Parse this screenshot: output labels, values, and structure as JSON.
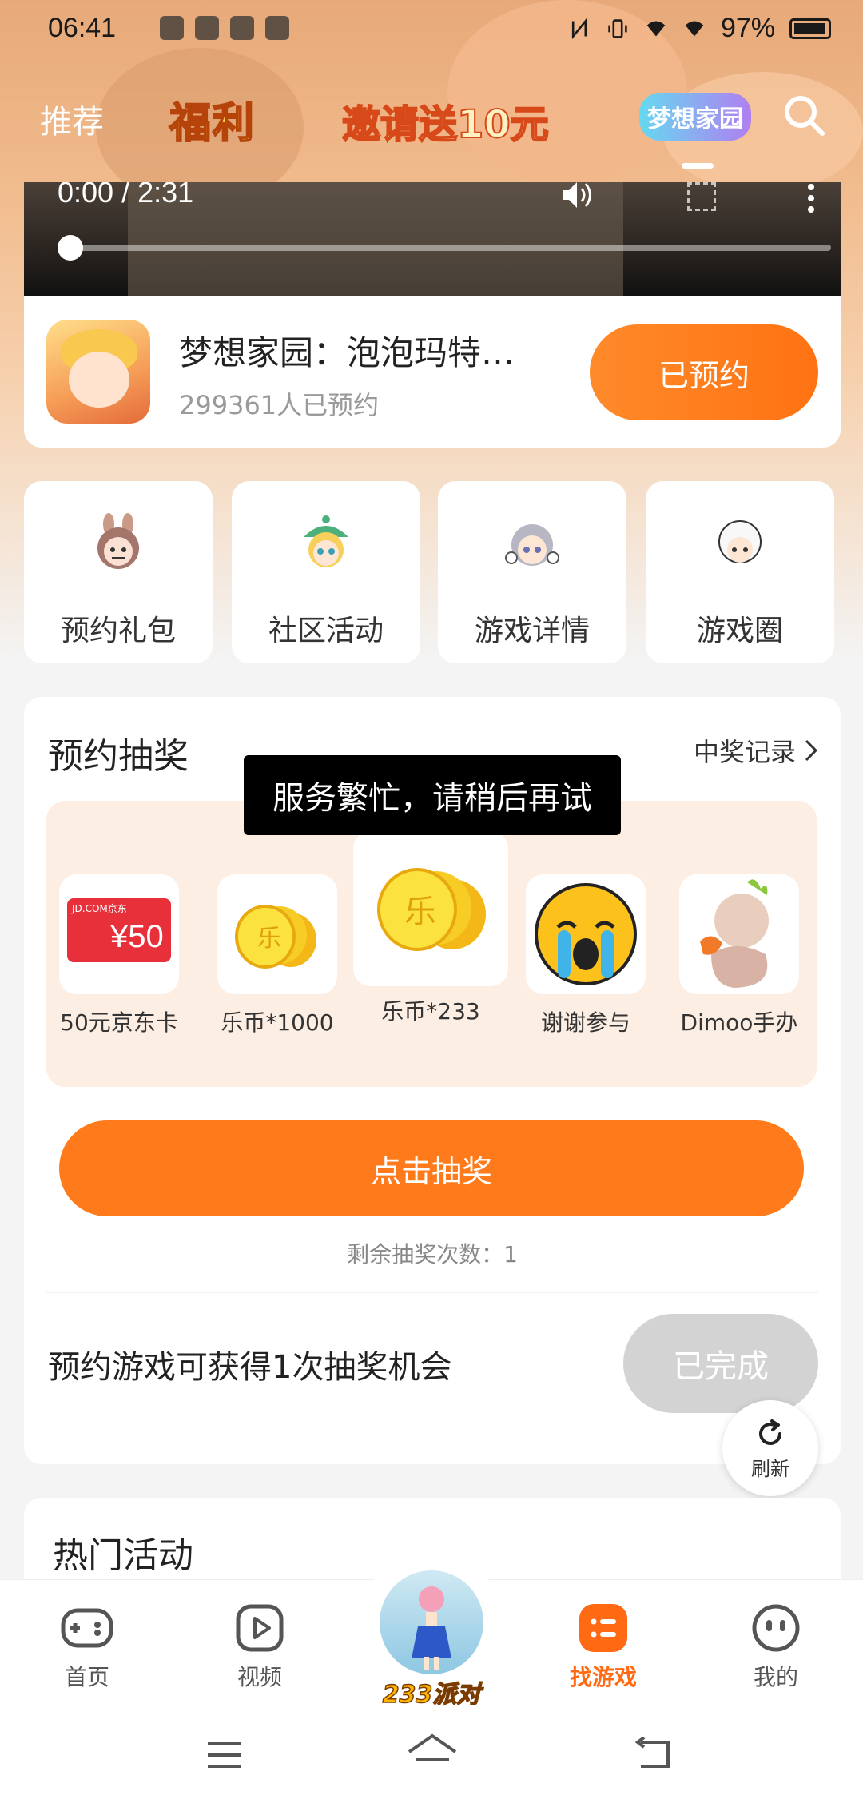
{
  "status_bar": {
    "time": "06:41",
    "battery": "97%"
  },
  "top_nav": {
    "recommend": "推荐",
    "fuli": "福利",
    "invite": "邀请送10元",
    "logo": "梦想家园"
  },
  "video": {
    "time": "0:00 / 2:31",
    "progress": 0.0
  },
  "game": {
    "title": "梦想家园：泡泡玛特…",
    "reservations": "299361人已预约",
    "reserve_button": "已预约"
  },
  "quick_entries": [
    {
      "label": "预约礼包",
      "icon": "labubu-icon"
    },
    {
      "label": "社区活动",
      "icon": "green-hat-girl-icon"
    },
    {
      "label": "游戏详情",
      "icon": "gray-hair-girl-icon"
    },
    {
      "label": "游戏圈",
      "icon": "dimoo-icon"
    }
  ],
  "lottery": {
    "title": "预约抽奖",
    "record_link": "中奖记录",
    "prizes": [
      {
        "label": "50元京东卡",
        "card_brand": "JD.COM京东",
        "card_value": "¥50"
      },
      {
        "label": "乐币*1000"
      },
      {
        "label": "乐币*233"
      },
      {
        "label": "谢谢参与"
      },
      {
        "label": "Dimoo手办"
      }
    ],
    "toast": "服务繁忙，请稍后再试",
    "draw_button": "点击抽奖",
    "remaining": "剩余抽奖次数：1",
    "task_text": "预约游戏可获得1次抽奖机会",
    "task_button": "已完成"
  },
  "refresh": "刷新",
  "hot": {
    "title": "热门活动"
  },
  "bottom_nav": {
    "home": "首页",
    "video": "视频",
    "center": "233派对",
    "find_game": "找游戏",
    "mine": "我的"
  },
  "colors": {
    "accent": "#ff7a1a",
    "prize_panel": "#fdeee4",
    "done_gray": "#d3d3d3"
  }
}
